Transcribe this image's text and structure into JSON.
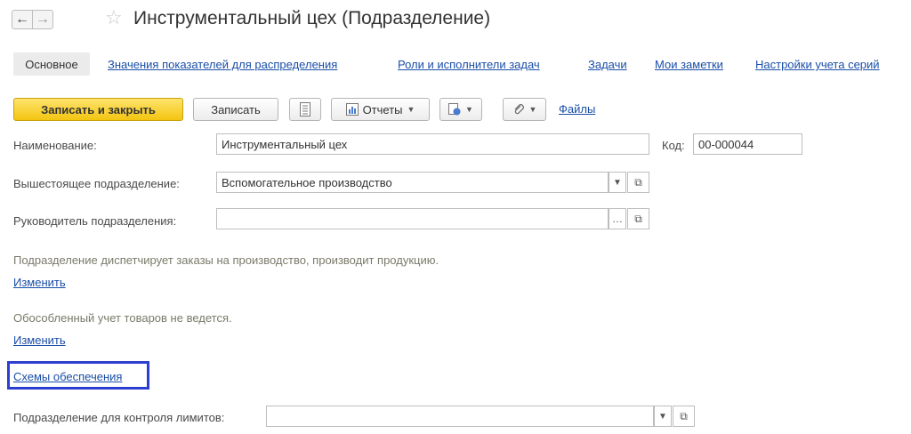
{
  "header": {
    "back_icon": "arrow-left-icon",
    "forward_icon": "arrow-right-icon",
    "favorite_icon": "star-icon",
    "title": "Инструментальный цех (Подразделение)"
  },
  "tabs": [
    {
      "label": "Основное",
      "active": true
    },
    {
      "label": "Значения показателей для распределения"
    },
    {
      "label": "Роли и исполнители задач"
    },
    {
      "label": "Задачи"
    },
    {
      "label": "Мои заметки"
    },
    {
      "label": "Настройки учета серий"
    }
  ],
  "toolbar": {
    "save_close_label": "Записать и закрыть",
    "save_label": "Записать",
    "reports_label": "Отчеты",
    "files_label": "Файлы",
    "accent_color": "#f3c510"
  },
  "form": {
    "name_label": "Наименование:",
    "name_value": "Инструментальный цех",
    "code_label": "Код:",
    "code_value": "00-000044",
    "parent_label": "Вышестоящее подразделение:",
    "parent_value": "Вспомогательное производство",
    "head_label": "Руководитель подразделения:",
    "head_value": "",
    "dispatch_info": "Подразделение диспетчирует заказы на производство, производит продукцию.",
    "dispatch_change": "Изменить",
    "accounting_info": "Обособленный учет товаров не ведется.",
    "accounting_change": "Изменить",
    "supply_schemes": "Схемы обеспечения",
    "limits_label": "Подразделение для контроля лимитов:",
    "limits_value": ""
  },
  "colors": {
    "link": "#1a4ea8",
    "highlight_border": "#2e3fcf"
  }
}
